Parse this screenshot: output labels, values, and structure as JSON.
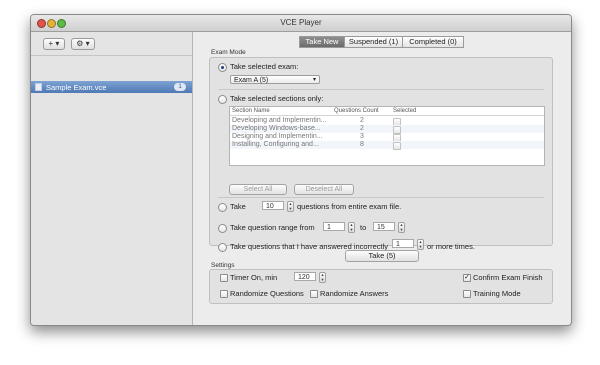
{
  "window": {
    "title": "VCE Player"
  },
  "sidebar": {
    "add_button": "+ ▾",
    "settings_button": "⚙ ▾",
    "exam_item": {
      "name": "Sample Exam.vce",
      "badge": "1"
    }
  },
  "tabs": [
    {
      "label": "Take New"
    },
    {
      "label": "Suspended (1)"
    },
    {
      "label": "Completed (0)"
    }
  ],
  "exam_mode": {
    "group_label": "Exam Mode",
    "take_selected_exam": "Take selected exam:",
    "selected_exam": "Exam A (5)",
    "take_selected_sections": "Take selected sections only:",
    "table": {
      "headers": [
        "Section Name",
        "Questions Count",
        "Selected"
      ],
      "rows": [
        {
          "name": "Developing and Implementin...",
          "count": "2"
        },
        {
          "name": "Developing Windows-base...",
          "count": "2"
        },
        {
          "name": "Designing and Implementin...",
          "count": "3"
        },
        {
          "name": "Installing, Configuring and...",
          "count": "8"
        }
      ]
    },
    "select_all": "Select All",
    "deselect_all": "Deselect All",
    "take_label": "Take",
    "take_count": "10",
    "take_suffix": "questions from entire exam file.",
    "range_label": "Take question range from",
    "range_from": "1",
    "range_to_label": "to",
    "range_to": "15",
    "incorrect_label": "Take questions that I have answered incorrectly",
    "incorrect_count": "1",
    "incorrect_suffix": "or more times."
  },
  "take_button": "Take (5)",
  "settings": {
    "group_label": "Settings",
    "timer_label": "Timer On, min",
    "timer_value": "120",
    "confirm_finish": "Confirm Exam Finish",
    "randomize_questions": "Randomize Questions",
    "randomize_answers": "Randomize Answers",
    "training_mode": "Training Mode"
  },
  "colors": {
    "close": "#e0524c",
    "minimize": "#e3b23a",
    "zoom": "#5fbb46",
    "selection": "#5b82bd"
  }
}
